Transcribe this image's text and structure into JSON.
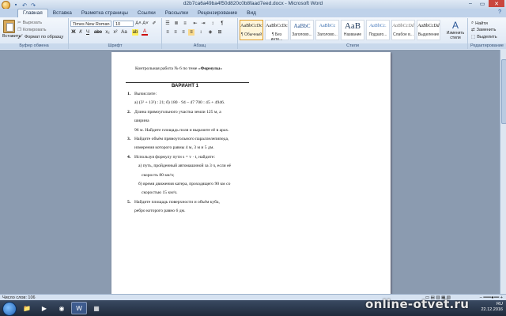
{
  "window": {
    "title": "d2b7ca6a49ba4f50d820c0b8faad7eed.docx - Microsoft Word",
    "minimize": "–",
    "maximize": "▭",
    "close": "✕"
  },
  "quick_access": {
    "save_icon": "floppy-icon",
    "undo_icon": "undo-icon",
    "redo_icon": "redo-icon"
  },
  "tabs": [
    "Главная",
    "Вставка",
    "Разметка страницы",
    "Ссылки",
    "Рассылки",
    "Рецензирование",
    "Вид"
  ],
  "ribbon": {
    "clipboard": {
      "paste_label": "Вставить",
      "cut_label": "Вырезать",
      "copy_label": "Копировать",
      "format_painter_label": "Формат по образцу",
      "group_label": "Буфер обмена"
    },
    "font": {
      "font_name": "Times New Roman",
      "font_size": "10",
      "group_label": "Шрифт",
      "bold": "Ж",
      "italic": "К",
      "underline": "Ч",
      "strike": "abe",
      "sub": "x₂",
      "sup": "x²",
      "case": "Аа",
      "grow": "A˄",
      "shrink": "A˅",
      "color": "A"
    },
    "paragraph": {
      "group_label": "Абзац",
      "pilcrow": "¶"
    },
    "styles": {
      "group_label": "Стили",
      "items": [
        {
          "preview": "AaBbCcDc",
          "name": "¶ Обычный"
        },
        {
          "preview": "AaBbCcDc",
          "name": "¶ Без инте..."
        },
        {
          "preview": "AaBbC",
          "name": "Заголово..."
        },
        {
          "preview": "AaBbCc",
          "name": "Заголово..."
        },
        {
          "preview": "AaB",
          "name": "Название"
        },
        {
          "preview": "AaBbCc.",
          "name": "Подзаго..."
        },
        {
          "preview": "AaBbCcDd",
          "name": "Слабое в..."
        },
        {
          "preview": "AaBbCcDd",
          "name": "Выделение"
        }
      ],
      "change_styles_label": "Изменить стили"
    },
    "editing": {
      "group_label": "Редактирование",
      "find_label": "Найти",
      "replace_label": "Заменить",
      "select_label": "Выделить"
    }
  },
  "document": {
    "header_prefix": "Контрольная работа № 6 по теме «",
    "header_topic": "Формулы",
    "header_suffix": "»",
    "variant": "ВАРИАНТ 1",
    "lines": [
      {
        "num": "1.",
        "text": "Вычислите:"
      },
      {
        "num": "",
        "text": "а) (3² + 13²) : 21;      б) 180 · 94 – 47 700 : 45 + 4946."
      },
      {
        "num": "2.",
        "text": "Длина прямоугольного участка земли 125 м, а"
      },
      {
        "num": "",
        "text": "ширина"
      },
      {
        "num": "",
        "text": "96 м. Найдите площадь поля и выразите её в арах."
      },
      {
        "num": "3.",
        "text": "Найдите объём прямоугольного параллелепипеда,"
      },
      {
        "num": "",
        "text": "измерения которого равны 4 м, 3 м и 5 дм."
      },
      {
        "num": "4.",
        "text": "Используя формулу пути s = v · t, найдите:"
      },
      {
        "num": "",
        "text": "а)  путь, пройденный автомашиной за 3 ч, если её"
      },
      {
        "num": "",
        "text": "скорость 80 км/ч;"
      },
      {
        "num": "",
        "text": "б)  время движения катера, проходящего 90 км со"
      },
      {
        "num": "",
        "text": "скоростью 15 км/ч."
      },
      {
        "num": "5.",
        "text": "Найдите площадь поверхности и объём куба,"
      },
      {
        "num": "",
        "text": "ребро которого равно 6 дм."
      }
    ]
  },
  "status_bar": {
    "word_count": "Число слов: 106"
  },
  "taskbar": {
    "tray_lang": "RU",
    "time": "",
    "date": "22.12.2016"
  },
  "watermark": "online-otvet.ru",
  "colors": {
    "accent": "#2b5797",
    "close": "#c9463d"
  }
}
